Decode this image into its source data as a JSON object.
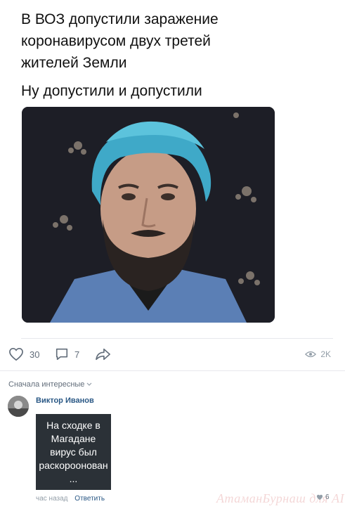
{
  "post": {
    "headline": "В ВОЗ допустили заражение коронавирусом двух третей жителей Земли",
    "caption": "Ну допустили и допустили"
  },
  "actions": {
    "likes": "30",
    "comments": "7",
    "views": "2K"
  },
  "comments_section": {
    "sort_label": "Сначала интересные",
    "comment": {
      "author": "Виктор Иванов",
      "image_text": "На сходке в Магадане вирус был раскороонован ...",
      "time": "час назад",
      "reply_label": "Ответить",
      "likes": "6"
    }
  },
  "watermark": "АтаманБурнаш для AI",
  "colors": {
    "link": "#2a5885",
    "muted": "#939ea8",
    "icon": "#626d7a"
  }
}
